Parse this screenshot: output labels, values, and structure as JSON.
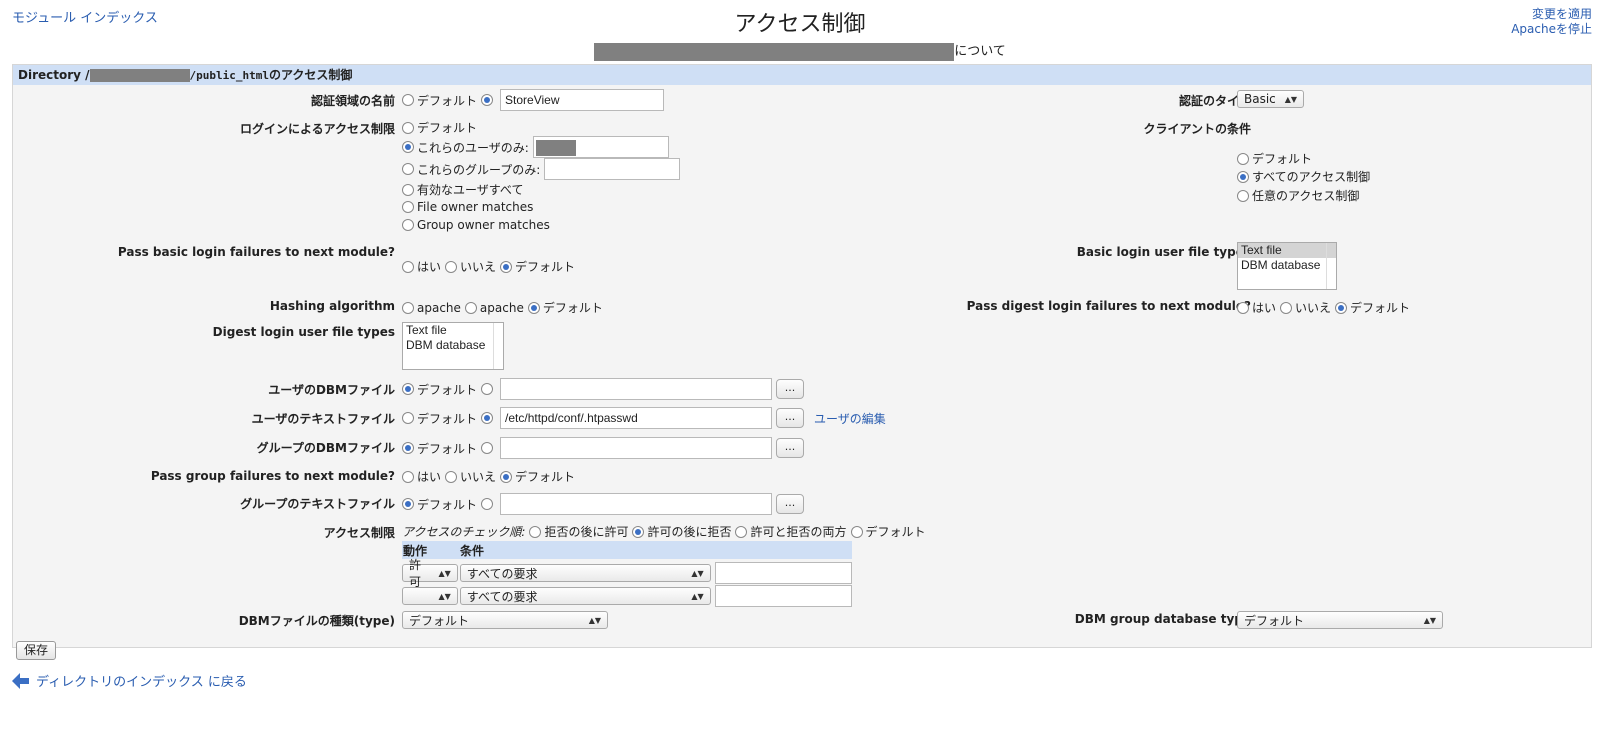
{
  "nav": {
    "module_index": "モジュール インデックス",
    "apply_changes": "変更を適用",
    "stop_apache": "Apacheを停止"
  },
  "title": "アクセス制御",
  "subtitle_suffix": "について",
  "panel": {
    "header_prefix": "Directory /",
    "header_path": "/public_html",
    "header_suffix": "のアクセス制御"
  },
  "fields": {
    "realm_label": "認証領域の名前",
    "realm_default": "デフォルト",
    "realm_value": "StoreView",
    "auth_type_label": "認証のタイプ",
    "auth_type_value": "Basic",
    "login_label": "ログインによるアクセス制限",
    "login_default": "デフォルト",
    "login_users": "これらのユーザのみ:",
    "login_groups": "これらのグループのみ:",
    "login_valid": "有効なユーザすべて",
    "login_file_owner": "File owner matches",
    "login_group_owner": "Group owner matches",
    "client_label": "クライアントの条件",
    "client_default": "デフォルト",
    "client_all": "すべてのアクセス制御",
    "client_any": "任意のアクセス制御",
    "pass_basic_label": "Pass basic login failures to next module?",
    "yes": "はい",
    "no": "いいえ",
    "default": "デフォルト",
    "basic_types_label": "Basic login user file types",
    "file_types": [
      "Text file",
      "DBM database"
    ],
    "hash_label": "Hashing algorithm",
    "hash_opt1": "apache",
    "hash_opt2": "apache",
    "pass_digest_label": "Pass digest login failures to next module?",
    "digest_types_label": "Digest login user file types",
    "user_dbm_label": "ユーザのDBMファイル",
    "user_text_label": "ユーザのテキストファイル",
    "user_text_value": "/etc/httpd/conf/.htpasswd",
    "edit_users": "ユーザの編集",
    "group_dbm_label": "グループのDBMファイル",
    "pass_group_label": "Pass group failures to next module?",
    "group_text_label": "グループのテキストファイル",
    "browse": "...",
    "access_label": "アクセス制限",
    "check_order": "アクセスのチェック順:",
    "order_deny_allow": "拒否の後に許可",
    "order_allow_deny": "許可の後に拒否",
    "order_both": "許可と拒否の両方",
    "order_default": "デフォルト",
    "col_action": "動作",
    "col_condition": "条件",
    "acl_rows": [
      {
        "action": "許可",
        "condition": "すべての要求"
      },
      {
        "action": "",
        "condition": "すべての要求"
      }
    ],
    "dbm_type_label": "DBMファイルの種類(type)",
    "dbm_type_value": "デフォルト",
    "dbm_group_type_label": "DBM group database type",
    "dbm_group_type_value": "デフォルト"
  },
  "save": "保存",
  "back_link": "ディレクトリのインデックス に戻る",
  "colors": {
    "link": "#2a5db0",
    "header_bg": "#cfdff5",
    "panel_bg": "#f4f4f4"
  }
}
